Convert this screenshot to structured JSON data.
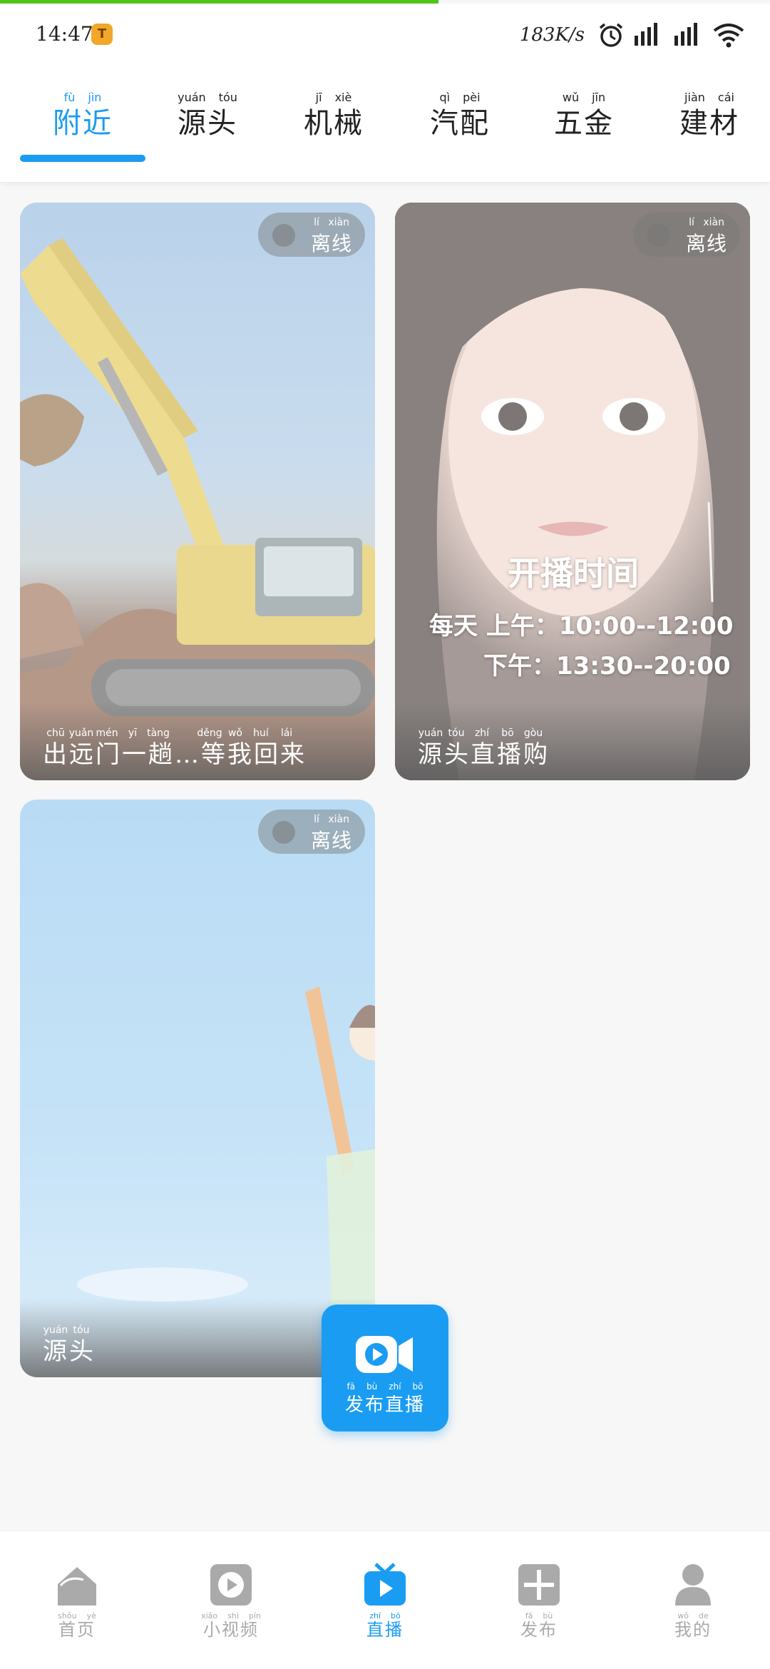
{
  "status_bar": {
    "time": "14:47",
    "app_icon_letter": "T",
    "net_speed": "183K/s",
    "icons": [
      "alarm-icon",
      "signal-icon",
      "signal-icon",
      "wifi-icon"
    ]
  },
  "tabs": [
    {
      "pinyin": [
        "fù",
        "jìn"
      ],
      "label": "附近",
      "active": true
    },
    {
      "pinyin": [
        "yuán",
        "tóu"
      ],
      "label": "源头",
      "active": false
    },
    {
      "pinyin": [
        "jī",
        "xiè"
      ],
      "label": "机械",
      "active": false
    },
    {
      "pinyin": [
        "qì",
        "pèi"
      ],
      "label": "汽配",
      "active": false
    },
    {
      "pinyin": [
        "wǔ",
        "jīn"
      ],
      "label": "五金",
      "active": false
    },
    {
      "pinyin": [
        "jiàn",
        "cái"
      ],
      "label": "建材",
      "active": false
    }
  ],
  "cards": [
    {
      "status_pinyin": "lí xiàn",
      "status": "离线",
      "title_pinyin": [
        "chū",
        "yuǎn",
        "mén",
        "yī",
        "tàng",
        "",
        "děng",
        "wǒ",
        "huí",
        "lái"
      ],
      "title": "出远门一趟…等我回来"
    },
    {
      "status_pinyin": "lí xiàn",
      "status": "离线",
      "overlay_heading": "开播时间",
      "overlay_line1": "每天 上午：10:00--12:00",
      "overlay_line2": "下午：13:30--20:00",
      "title_pinyin": [
        "yuán",
        "tóu",
        "zhí",
        "bō",
        "gòu"
      ],
      "title": "源头直播购"
    },
    {
      "status_pinyin": "lí xiàn",
      "status": "离线",
      "title_pinyin": [
        "yuán",
        "tóu"
      ],
      "title": "源头"
    }
  ],
  "fab": {
    "pinyin": [
      "fā",
      "bù",
      "zhí",
      "bō"
    ],
    "label": "发布直播",
    "icon": "video-camera-icon"
  },
  "bottom_nav": [
    {
      "pinyin": [
        "shǒu",
        "yè"
      ],
      "label": "首页",
      "icon": "home-icon",
      "active": false
    },
    {
      "pinyin": [
        "xiǎo",
        "shì",
        "pín"
      ],
      "label": "小视频",
      "icon": "video-play-icon",
      "active": false
    },
    {
      "pinyin": [
        "zhí",
        "bō"
      ],
      "label": "直播",
      "icon": "tv-live-icon",
      "active": true
    },
    {
      "pinyin": [
        "fā",
        "bù"
      ],
      "label": "发布",
      "icon": "plus-icon",
      "active": false
    },
    {
      "pinyin": [
        "wǒ",
        "de"
      ],
      "label": "我的",
      "icon": "user-icon",
      "active": false
    }
  ],
  "colors": {
    "accent": "#1a9cf2",
    "progress": "#52c41a",
    "inactive": "#aaaaaa"
  },
  "top_progress_fraction": 0.57
}
